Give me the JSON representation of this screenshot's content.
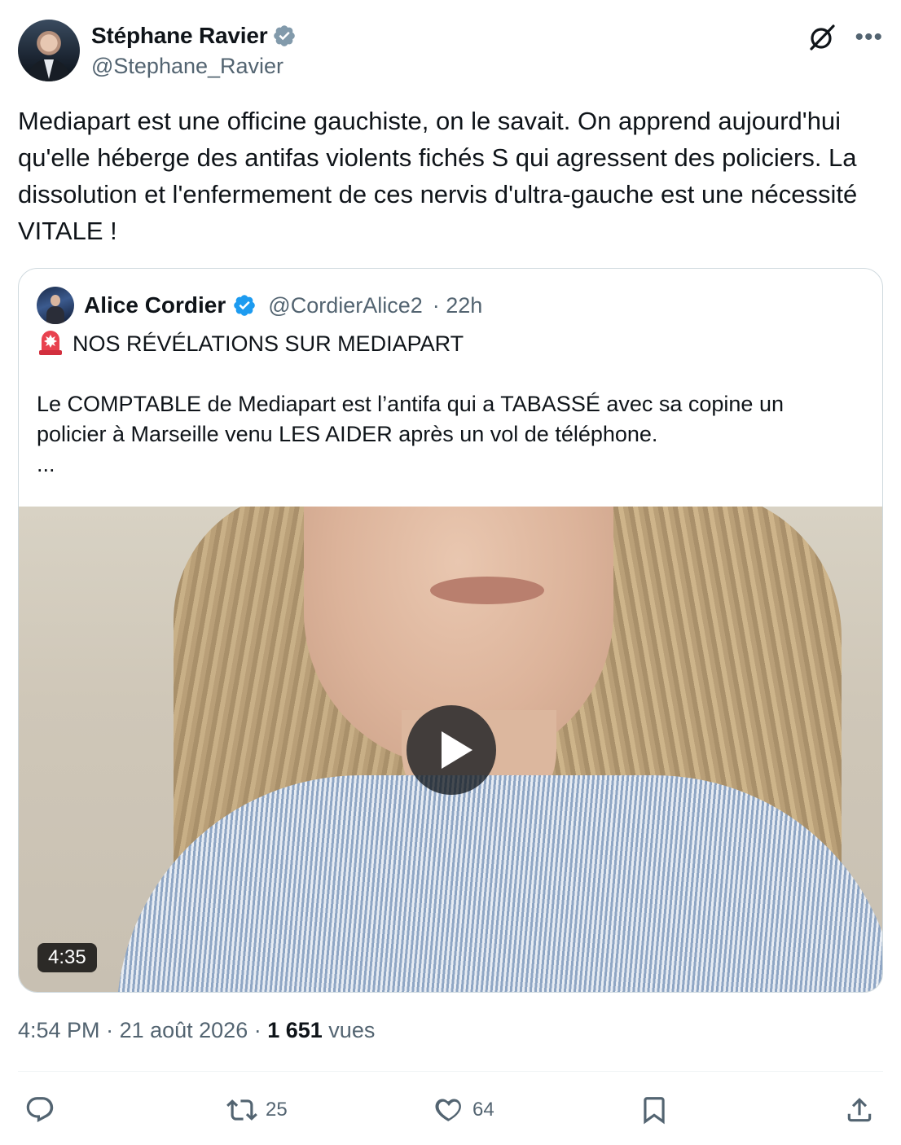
{
  "author": {
    "name": "Stéphane Ravier",
    "handle": "@Stephane_Ravier"
  },
  "tweet": {
    "text": "Mediapart est une officine gauchiste, on le savait. On apprend aujourd'hui qu'elle héberge des antifas violents fichés S qui agressent des policiers. La dissolution et l'enfermement de ces nervis d'ultra-gauche est une nécessité VITALE !"
  },
  "quote": {
    "name": "Alice Cordier",
    "handle": "@CordierAlice2",
    "time": "· 22h",
    "headline": "NOS RÉVÉLATIONS SUR MEDIAPART",
    "body": "Le COMPTABLE de Mediapart est l’antifa qui a TABASSÉ avec sa copine un policier à Marseille venu LES AIDER après un vol de téléphone.\n...",
    "video_duration": "4:35"
  },
  "meta": {
    "time": "4:54 PM",
    "separator1": " · ",
    "date": "21 août 2026",
    "separator2": " · ",
    "views_count": "1 651",
    "views_label": " vues"
  },
  "actions": {
    "reply_count": "",
    "retweet_count": "25",
    "like_count": "64"
  },
  "colors": {
    "verified": "#1d9bf0",
    "author_verified": "#829aab",
    "text": "#0f1419",
    "secondary": "#536471"
  },
  "icons": [
    "verified-icon",
    "grok-icon",
    "more-icon",
    "siren-emoji-icon",
    "play-icon",
    "reply-icon",
    "retweet-icon",
    "like-icon",
    "bookmark-icon",
    "share-icon"
  ]
}
